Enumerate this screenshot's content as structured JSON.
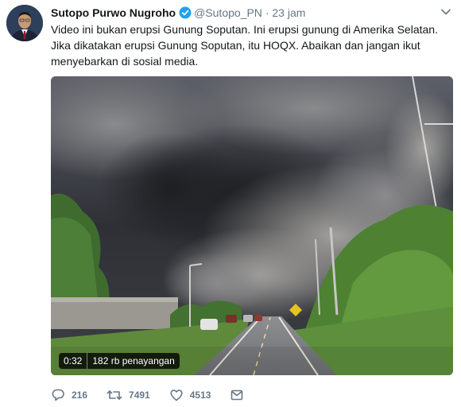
{
  "tweet": {
    "author_name": "Sutopo Purwo Nugroho",
    "handle": "@Sutopo_PN",
    "separator": "·",
    "time": "23 jam",
    "text_lines": [
      "Video ini bukan erupsi Gunung Soputan. Ini erupsi gunung di Amerika Selatan.",
      "Jika dikatakan erupsi Gunung Soputan, itu HOQX. Abaikan dan jangan ikut",
      "menyebarkan di sosial media."
    ]
  },
  "video": {
    "duration": "0:32",
    "views": "182 rb penayangan"
  },
  "actions": {
    "reply_count": "216",
    "retweet_count": "7491",
    "like_count": "4513"
  },
  "colors": {
    "verified": "#1da1f2",
    "muted_text": "#657786",
    "primary_text": "#14171a"
  },
  "icons": [
    "verified-badge-icon",
    "caret-down-icon",
    "reply-icon",
    "retweet-icon",
    "like-icon",
    "dm-icon"
  ]
}
